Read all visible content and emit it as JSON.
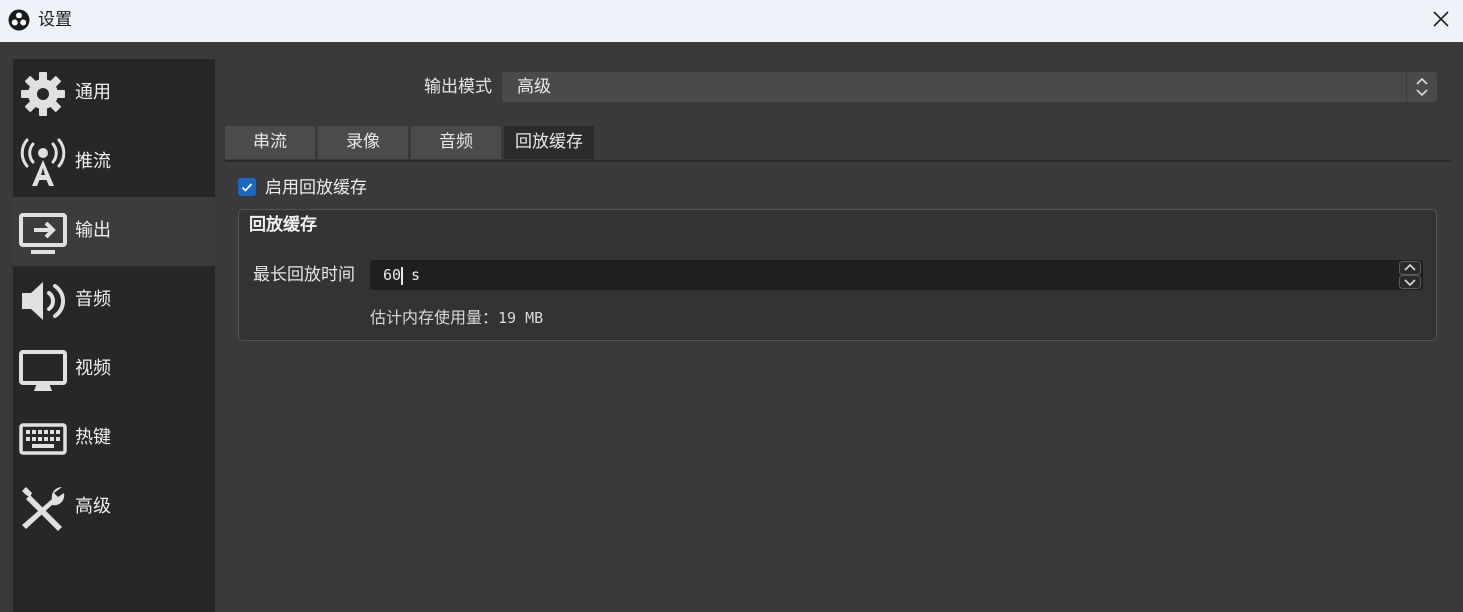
{
  "window": {
    "title": "设置",
    "icon": "obs-logo-icon",
    "close_icon": "close-icon"
  },
  "sidebar": {
    "items": [
      {
        "label": "通用",
        "icon": "gear-icon",
        "active": false
      },
      {
        "label": "推流",
        "icon": "broadcast-antenna-icon",
        "active": false
      },
      {
        "label": "输出",
        "icon": "monitor-output-icon",
        "active": true
      },
      {
        "label": "音频",
        "icon": "speaker-icon",
        "active": false
      },
      {
        "label": "视频",
        "icon": "monitor-icon",
        "active": false
      },
      {
        "label": "热键",
        "icon": "keyboard-icon",
        "active": false
      },
      {
        "label": "高级",
        "icon": "tools-icon",
        "active": false
      }
    ]
  },
  "output": {
    "mode_label": "输出模式",
    "mode_value": "高级"
  },
  "tabs": [
    {
      "label": "串流",
      "active": false
    },
    {
      "label": "录像",
      "active": false
    },
    {
      "label": "音频",
      "active": false
    },
    {
      "label": "回放缓存",
      "active": true
    }
  ],
  "replay": {
    "enable_label": "启用回放缓存",
    "enabled": true,
    "group_title": "回放缓存",
    "max_time_label": "最长回放时间",
    "max_time_value": "60",
    "max_time_unit": "s",
    "memory_label": "估计内存使用量：",
    "memory_value": "19 MB"
  },
  "colors": {
    "background": "#3a3a3a",
    "sidebar": "#272727",
    "sidebar_active": "#3c3c3c",
    "accent": "#1767c5",
    "titlebar": "#eef2f9"
  }
}
